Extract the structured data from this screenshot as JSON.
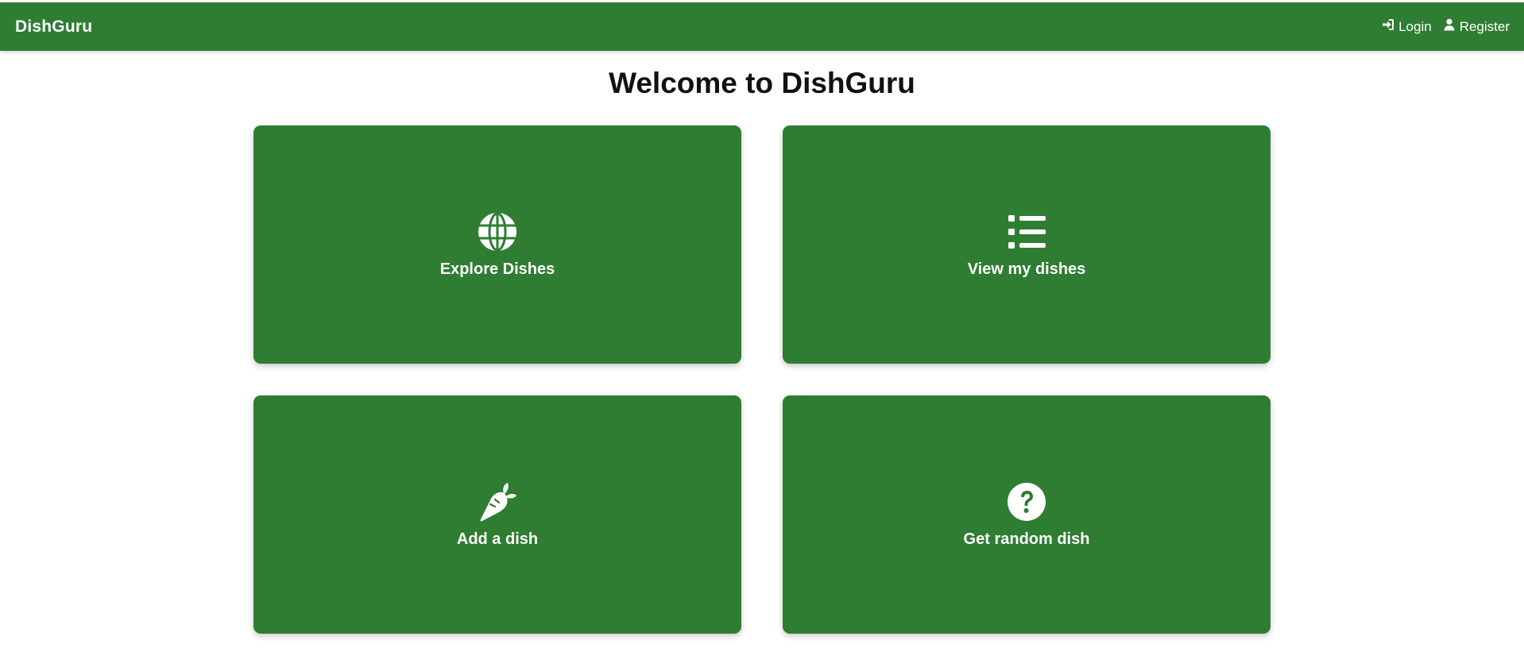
{
  "navbar": {
    "brand": "DishGuru",
    "links": [
      {
        "label": "Login",
        "icon": "sign-in-icon"
      },
      {
        "label": "Register",
        "icon": "user-icon"
      }
    ]
  },
  "main": {
    "title": "Welcome to DishGuru",
    "cards": [
      {
        "label": "Explore Dishes",
        "icon": "globe-icon"
      },
      {
        "label": "View my dishes",
        "icon": "list-icon"
      },
      {
        "label": "Add a dish",
        "icon": "carrot-icon"
      },
      {
        "label": "Get random dish",
        "icon": "question-circle-icon"
      }
    ]
  },
  "colors": {
    "primary": "#2e7d32",
    "text_on_primary": "#ffffff",
    "background": "#ffffff"
  }
}
